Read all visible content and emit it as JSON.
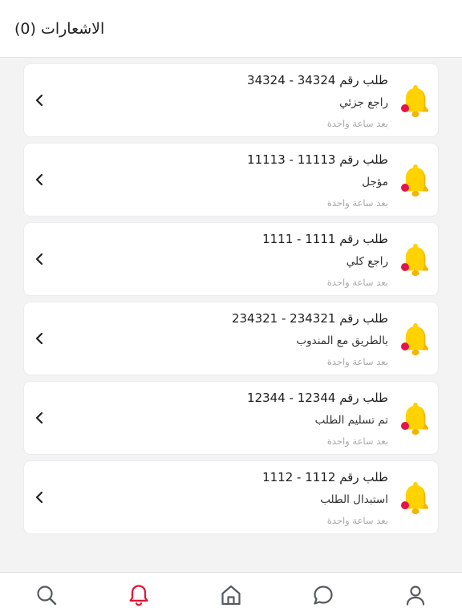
{
  "header": {
    "title": "الاشعارات (0)"
  },
  "colors": {
    "bell": "#ffd200",
    "bell_shade": "#f4b400",
    "badge": "#e4134f",
    "active_nav": "#e3132f",
    "nav": "#555a60"
  },
  "notifications": [
    {
      "title": "طلب رقم 34324 - 34324",
      "status": "راجع جزئي",
      "time": "بعد ساعة واحدة"
    },
    {
      "title": "طلب رقم 11113 - 11113",
      "status": "مؤجل",
      "time": "بعد ساعة واحدة"
    },
    {
      "title": "طلب رقم 1111 - 1111",
      "status": "راجع كلي",
      "time": "بعد ساعة واحدة"
    },
    {
      "title": "طلب رقم 234321 - 234321",
      "status": "بالطريق مع المندوب",
      "time": "بعد ساعة واحدة"
    },
    {
      "title": "طلب رقم 12344 - 12344",
      "status": "تم تسليم الطلب",
      "time": "بعد ساعة واحدة"
    },
    {
      "title": "طلب رقم 1112 - 1112",
      "status": "استبدال الطلب",
      "time": "بعد ساعة واحدة"
    }
  ],
  "nav": [
    {
      "icon": "search-icon",
      "active": false
    },
    {
      "icon": "bell-icon",
      "active": true
    },
    {
      "icon": "home-icon",
      "active": false
    },
    {
      "icon": "chat-icon",
      "active": false
    },
    {
      "icon": "user-icon",
      "active": false
    }
  ]
}
